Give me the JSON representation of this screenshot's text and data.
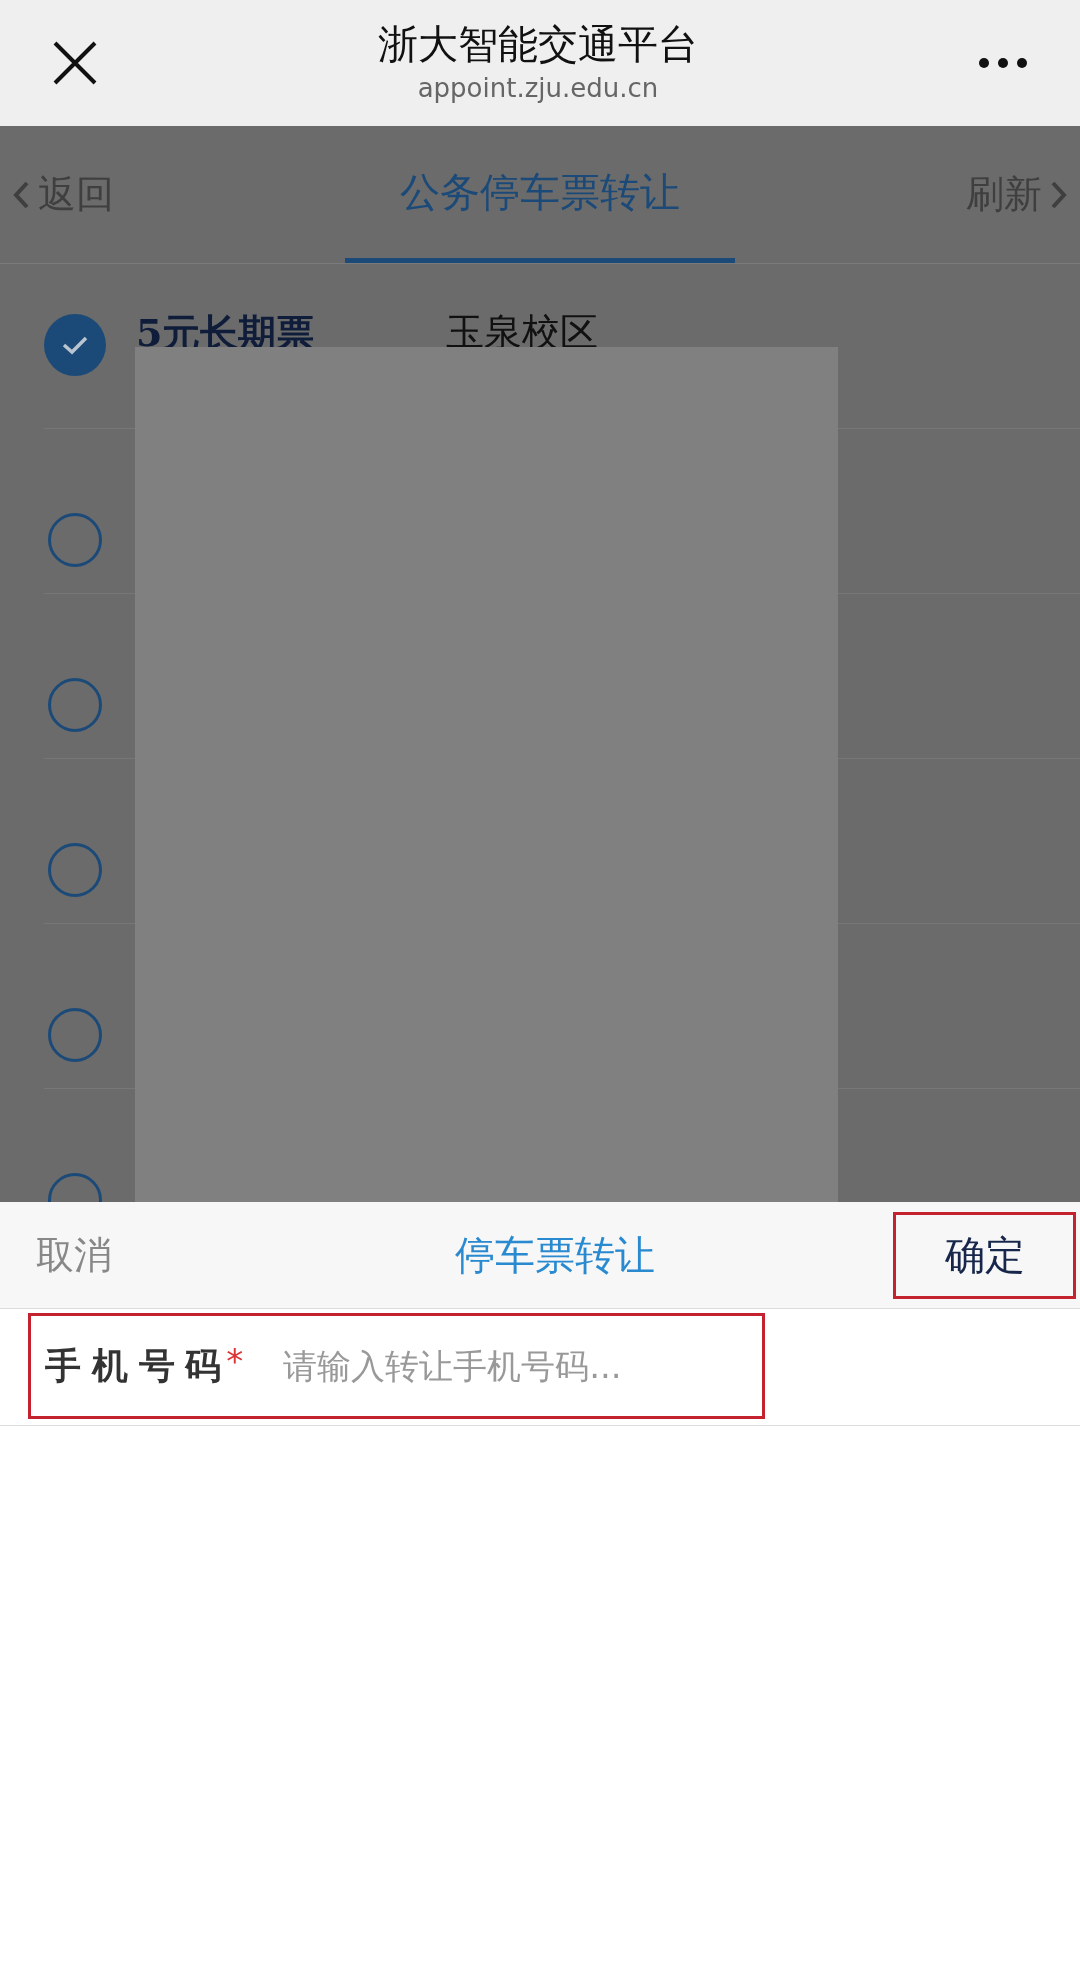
{
  "window": {
    "title": "浙大智能交通平台",
    "url": "appoint.zju.edu.cn"
  },
  "nav": {
    "back": "返回",
    "title": "公务停车票转让",
    "refresh": "刷新"
  },
  "tickets": [
    {
      "name": "5元长期票",
      "campus": "玉泉校区",
      "selected": true
    },
    {
      "selected": false
    },
    {
      "selected": false
    },
    {
      "selected": false
    },
    {
      "selected": false
    },
    {
      "selected": false
    }
  ],
  "sheet": {
    "cancel": "取消",
    "title": "停车票转让",
    "confirm": "确定",
    "confirm_annotated": true,
    "field": {
      "label": "手机号码",
      "required_mark": "*",
      "placeholder": "请输入转让手机号码...",
      "annotated": true
    }
  }
}
